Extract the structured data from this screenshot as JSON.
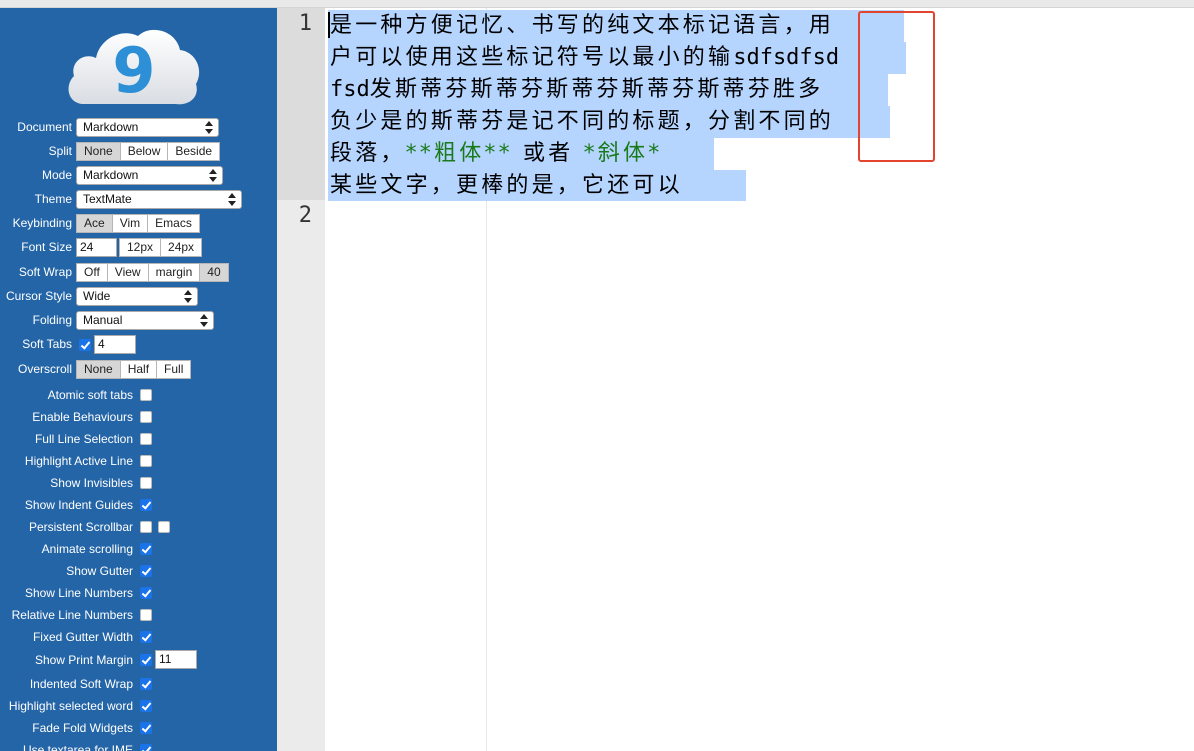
{
  "sidebar": {
    "settings": [
      {
        "label": "Document",
        "type": "select",
        "value": "Markdown"
      },
      {
        "label": "Split",
        "type": "buttons",
        "options": [
          "None",
          "Below",
          "Beside"
        ],
        "active": "None"
      },
      {
        "label": "Mode",
        "type": "select",
        "value": "Markdown"
      },
      {
        "label": "Theme",
        "type": "select",
        "value": "TextMate"
      },
      {
        "label": "Keybinding",
        "type": "buttons",
        "options": [
          "Ace",
          "Vim",
          "Emacs"
        ],
        "active": "Ace"
      },
      {
        "label": "Font Size",
        "type": "fontsize",
        "value": "24",
        "options": [
          "12px",
          "24px"
        ]
      },
      {
        "label": "Soft Wrap",
        "type": "buttons",
        "options": [
          "Off",
          "View",
          "margin",
          "40"
        ],
        "active": "40"
      },
      {
        "label": "Cursor Style",
        "type": "select",
        "value": "Wide"
      },
      {
        "label": "Folding",
        "type": "select",
        "value": "Manual"
      },
      {
        "label": "Soft Tabs",
        "type": "checknum",
        "checked": true,
        "value": "4"
      },
      {
        "label": "Overscroll",
        "type": "buttons",
        "options": [
          "None",
          "Half",
          "Full"
        ],
        "active": "None"
      }
    ],
    "checkboxes": [
      {
        "label": "Atomic soft tabs",
        "checked": false
      },
      {
        "label": "Enable Behaviours",
        "checked": false
      },
      {
        "label": "Full Line Selection",
        "checked": false
      },
      {
        "label": "Highlight Active Line",
        "checked": false
      },
      {
        "label": "Show Invisibles",
        "checked": false
      },
      {
        "label": "Show Indent Guides",
        "checked": true
      },
      {
        "label": "Persistent Scrollbar",
        "checked": false,
        "second_checkbox": false
      },
      {
        "label": "Animate scrolling",
        "checked": true
      },
      {
        "label": "Show Gutter",
        "checked": true
      },
      {
        "label": "Show Line Numbers",
        "checked": true
      },
      {
        "label": "Relative Line Numbers",
        "checked": false
      },
      {
        "label": "Fixed Gutter Width",
        "checked": true
      },
      {
        "label": "Show Print Margin",
        "checked": true,
        "value": "11"
      },
      {
        "label": "Indented Soft Wrap",
        "checked": true
      },
      {
        "label": "Highlight selected word",
        "checked": true
      },
      {
        "label": "Fade Fold Widgets",
        "checked": true
      },
      {
        "label": "Use textarea for IME",
        "checked": true
      }
    ]
  },
  "editor": {
    "line_numbers": [
      "1",
      "2"
    ],
    "lines": {
      "l1": "是一种方便记忆、书写的纯文本标记语言，用",
      "l2a": "户可以使用这些标记符号以最小的输",
      "l2b": "sdfsdfsd",
      "l3a": "fsd",
      "l3b": "发斯蒂芬斯蒂芬斯蒂芬斯蒂芬斯蒂芬胜多",
      "l4": "负少是的斯蒂芬是记不同的标题，分割不同的",
      "l5a": "段落，",
      "l5b": "**粗体**",
      "l5c": " 或者 ",
      "l5d": "*斜体*",
      "l6": "某些文字，更棒的是，它还可以"
    }
  },
  "colors": {
    "sidebar_bg": "#2465a7",
    "selection": "#b5d5ff",
    "markdown_strong": "#1a7a1a",
    "annotation_box": "#e3442f"
  }
}
